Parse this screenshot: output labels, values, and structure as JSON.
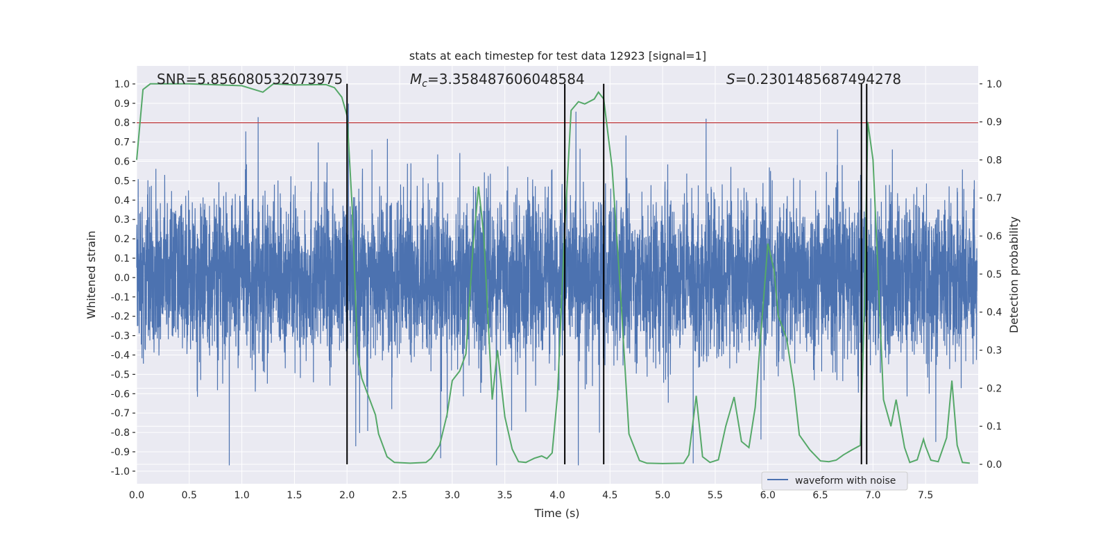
{
  "chart_data": {
    "type": "line",
    "title": "stats at each timestep for test data 12923 [signal=1]",
    "xlabel": "Time (s)",
    "ylabel": "Whitened strain",
    "ylabel_right": "Detection probability",
    "xlim": [
      0,
      8
    ],
    "ylim": [
      -1.065,
      1.093
    ],
    "ylim_right": [
      -0.051,
      1.047
    ],
    "grid": true,
    "x_ticks": [
      "0.0",
      "0.5",
      "1.0",
      "1.5",
      "2.0",
      "2.5",
      "3.0",
      "3.5",
      "4.0",
      "4.5",
      "5.0",
      "5.5",
      "6.0",
      "6.5",
      "7.0",
      "7.5"
    ],
    "y_ticks": [
      "1.0",
      "0.9",
      "0.8",
      "0.7",
      "0.6",
      "0.5",
      "0.4",
      "0.3",
      "0.2",
      "0.1",
      "0.0",
      "-0.1",
      "-0.2",
      "-0.3",
      "-0.4",
      "-0.5",
      "-0.6",
      "-0.7",
      "-0.8",
      "-0.9",
      "-1.0"
    ],
    "y_ticks_right": [
      "1.0",
      "0.9",
      "0.8",
      "0.7",
      "0.6",
      "0.5",
      "0.4",
      "0.3",
      "0.2",
      "0.1",
      "0.0"
    ],
    "legend": {
      "placement": "lower-right",
      "entries": [
        "waveform with noise"
      ]
    },
    "annotations": {
      "snr": "SNR=5.856080532073975",
      "mc": {
        "symbol": "M",
        "sub": "c",
        "value": "=3.358487606048584"
      },
      "s": {
        "symbol": "S",
        "value": "=0.2301485687494278"
      }
    },
    "series": [
      {
        "name": "waveform with noise",
        "axis": "left",
        "color": "#4C72B0",
        "kind": "noise waveform, amplitude roughly within -0.97 to 0.99"
      },
      {
        "axis": "left",
        "color": "#C44E52",
        "kind": "threshold",
        "y": 0.8
      },
      {
        "axis": "right",
        "color": "#55A868",
        "kind": "detection probability",
        "x": [
          0,
          0.06,
          0.13,
          0.5,
          1.0,
          1.2,
          1.3,
          1.5,
          1.8,
          1.88,
          1.95,
          2.0,
          2.05,
          2.1,
          2.14,
          2.27,
          2.3,
          2.38,
          2.45,
          2.6,
          2.75,
          2.8,
          2.88,
          2.95,
          3.0,
          3.07,
          3.13,
          3.2,
          3.25,
          3.3,
          3.38,
          3.43,
          3.5,
          3.57,
          3.63,
          3.7,
          3.78,
          3.85,
          3.9,
          3.95,
          4.0,
          4.07,
          4.13,
          4.2,
          4.26,
          4.35,
          4.39,
          4.44,
          4.52,
          4.6,
          4.68,
          4.78,
          4.85,
          5.0,
          5.2,
          5.25,
          5.32,
          5.38,
          5.45,
          5.53,
          5.6,
          5.68,
          5.75,
          5.82,
          5.88,
          5.95,
          6.0,
          6.06,
          6.1,
          6.18,
          6.25,
          6.3,
          6.4,
          6.5,
          6.58,
          6.65,
          6.72,
          6.8,
          6.88,
          6.92,
          6.95,
          7.0,
          7.05,
          7.1,
          7.17,
          7.22,
          7.3,
          7.35,
          7.42,
          7.48,
          7.5,
          7.55,
          7.62,
          7.7,
          7.75,
          7.8,
          7.85,
          7.92
        ],
        "y": [
          0.8,
          0.985,
          1.0,
          1.0,
          0.995,
          0.978,
          1.0,
          0.997,
          0.998,
          0.99,
          0.965,
          0.916,
          0.67,
          0.29,
          0.226,
          0.13,
          0.08,
          0.02,
          0.005,
          0.003,
          0.005,
          0.016,
          0.05,
          0.13,
          0.22,
          0.245,
          0.29,
          0.58,
          0.73,
          0.6,
          0.17,
          0.3,
          0.125,
          0.04,
          0.007,
          0.005,
          0.016,
          0.022,
          0.015,
          0.03,
          0.18,
          0.62,
          0.93,
          0.953,
          0.947,
          0.96,
          0.978,
          0.96,
          0.78,
          0.45,
          0.08,
          0.01,
          0.003,
          0.002,
          0.003,
          0.025,
          0.18,
          0.02,
          0.005,
          0.012,
          0.1,
          0.177,
          0.06,
          0.044,
          0.15,
          0.4,
          0.58,
          0.51,
          0.39,
          0.33,
          0.2,
          0.077,
          0.038,
          0.009,
          0.007,
          0.011,
          0.025,
          0.038,
          0.05,
          0.43,
          0.9,
          0.8,
          0.49,
          0.17,
          0.1,
          0.17,
          0.044,
          0.005,
          0.012,
          0.066,
          0.047,
          0.011,
          0.007,
          0.07,
          0.22,
          0.05,
          0.005,
          0.003
        ]
      },
      {
        "axis": "right",
        "color": "#000000",
        "kind": "vertical markers",
        "x": [
          2.0,
          4.07,
          4.44,
          6.89,
          6.94
        ],
        "y_range": [
          0,
          1
        ]
      }
    ]
  }
}
